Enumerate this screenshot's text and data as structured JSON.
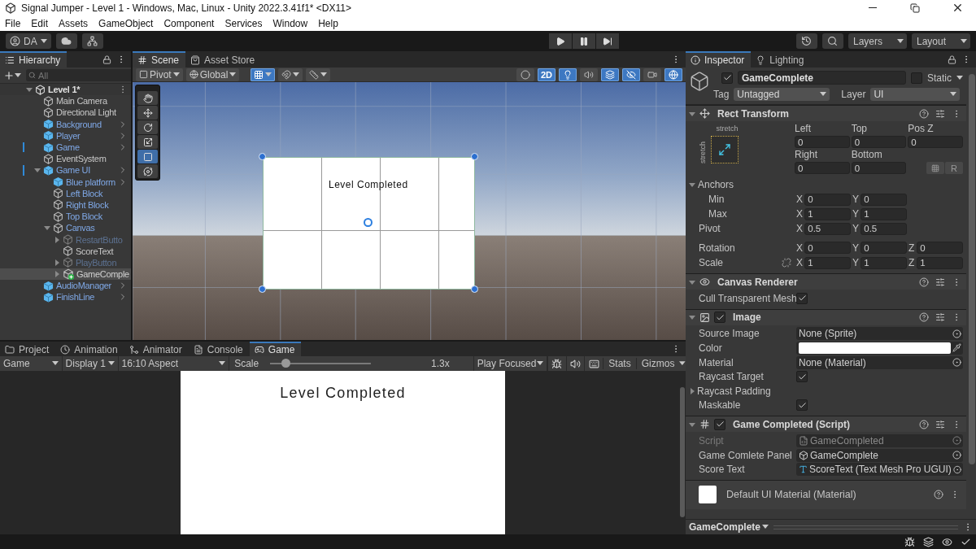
{
  "window": {
    "title": "Signal Jumper - Level 1 - Windows, Mac, Linux - Unity 2022.3.41f1* <DX11>"
  },
  "menu": [
    "File",
    "Edit",
    "Assets",
    "GameObject",
    "Component",
    "Services",
    "Window",
    "Help"
  ],
  "toolbar": {
    "account": "DA",
    "layers": "Layers",
    "layout": "Layout"
  },
  "hierarchy": {
    "tab": "Hierarchy",
    "search": {
      "placeholder": "All"
    },
    "root": {
      "label": "Level 1*",
      "expanded": true,
      "children": [
        {
          "label": "Main Camera",
          "kind": "object",
          "selected": false,
          "disabled": false,
          "modified": false
        },
        {
          "label": "Directional Light",
          "kind": "object",
          "selected": false,
          "disabled": false,
          "modified": false
        },
        {
          "label": "Background",
          "kind": "prefab",
          "selected": false,
          "disabled": false,
          "modified": false
        },
        {
          "label": "Player",
          "kind": "prefab",
          "selected": false,
          "disabled": false,
          "modified": false
        },
        {
          "label": "Game",
          "kind": "prefab",
          "selected": false,
          "disabled": false,
          "modified": true
        },
        {
          "label": "EventSystem",
          "kind": "object",
          "selected": false,
          "disabled": false,
          "modified": false
        },
        {
          "label": "Game UI",
          "kind": "prefab",
          "selected": false,
          "disabled": false,
          "modified": true,
          "expanded": true,
          "children": [
            {
              "label": "Blue platform",
              "kind": "prefab",
              "selected": false,
              "disabled": false,
              "modified": false
            },
            {
              "label": "Left Block",
              "kind": "prefab-part",
              "selected": false,
              "disabled": false,
              "modified": false
            },
            {
              "label": "Right Block",
              "kind": "prefab-part",
              "selected": false,
              "disabled": false,
              "modified": false
            },
            {
              "label": "Top Block",
              "kind": "prefab-part",
              "selected": false,
              "disabled": false,
              "modified": false
            },
            {
              "label": "Canvas",
              "kind": "prefab-part",
              "selected": false,
              "disabled": false,
              "modified": false,
              "expanded": true,
              "children": [
                {
                  "label": "RestartButto",
                  "kind": "prefab-part",
                  "selected": false,
                  "disabled": true,
                  "modified": false,
                  "expanded": false
                },
                {
                  "label": "ScoreText",
                  "kind": "object",
                  "selected": false,
                  "disabled": false,
                  "modified": false
                },
                {
                  "label": "PlayButton",
                  "kind": "prefab-part",
                  "selected": false,
                  "disabled": true,
                  "modified": false,
                  "expanded": false
                },
                {
                  "label": "GameComple",
                  "kind": "added",
                  "selected": true,
                  "disabled": false,
                  "modified": false,
                  "expanded": false
                }
              ]
            }
          ]
        },
        {
          "label": "AudioManager",
          "kind": "prefab",
          "selected": false,
          "disabled": false,
          "modified": false
        },
        {
          "label": "FinishLine",
          "kind": "prefab",
          "selected": false,
          "disabled": false,
          "modified": false
        }
      ]
    }
  },
  "scene": {
    "tabs": [
      {
        "label": "Scene",
        "kind": "scene",
        "selected": true
      },
      {
        "label": "Asset Store",
        "kind": "store",
        "selected": false
      }
    ],
    "pivot": "Pivot",
    "space": "Global",
    "snap_buttons": [
      {
        "kind": "grid",
        "on": true
      },
      {
        "kind": "increment",
        "on": false
      },
      {
        "kind": "ruler",
        "on": false
      }
    ],
    "view_buttons": [
      {
        "kind": "shading",
        "on": false
      },
      {
        "kind": "mode",
        "label": "2D",
        "on": true
      },
      {
        "kind": "light",
        "on": true
      },
      {
        "kind": "audio",
        "on": false
      },
      {
        "kind": "effects",
        "on": true
      },
      {
        "kind": "visibility",
        "on": true
      },
      {
        "kind": "camera",
        "on": false
      },
      {
        "kind": "gizmos",
        "on": true
      }
    ],
    "tools": [
      {
        "kind": "hand",
        "selected": false
      },
      {
        "kind": "move",
        "selected": false
      },
      {
        "kind": "rotate",
        "selected": false
      },
      {
        "kind": "scale",
        "selected": false
      },
      {
        "kind": "rect",
        "selected": true
      },
      {
        "kind": "transform",
        "selected": false
      }
    ],
    "panel_text": "Level Completed"
  },
  "bottom": {
    "tabs": [
      {
        "label": "Project",
        "kind": "project",
        "selected": false
      },
      {
        "label": "Animation",
        "kind": "animation",
        "selected": false
      },
      {
        "label": "Animator",
        "kind": "animator",
        "selected": false
      },
      {
        "label": "Console",
        "kind": "console",
        "selected": false
      },
      {
        "label": "Game",
        "kind": "game",
        "selected": true
      }
    ],
    "game_toolbar": {
      "view": "Game",
      "display": "Display 1",
      "aspect": "16:10 Aspect",
      "scale_label": "Scale",
      "scale": {
        "level": 0.12
      },
      "scale_value": "1.3x",
      "play_mode": "Play Focused",
      "stats": "Stats",
      "gizmos": "Gizmos"
    },
    "game_text": "Level Completed"
  },
  "inspector": {
    "tabs": [
      {
        "label": "Inspector",
        "kind": "inspector",
        "selected": true
      },
      {
        "label": "Lighting",
        "kind": "lighting",
        "selected": false
      }
    ],
    "object": {
      "active": true,
      "name": "GameComplete",
      "static": false,
      "static_label": "Static",
      "tag_label": "Tag",
      "tag": "Untagged",
      "layer_label": "Layer",
      "layer": "UI"
    },
    "rect_transform": {
      "title": "Rect Transform",
      "expanded": true,
      "preset_h": "stretch",
      "preset_v": "stretch",
      "fields": [
        {
          "label": "Left",
          "value": "0"
        },
        {
          "label": "Top",
          "value": "0"
        },
        {
          "label": "Pos Z",
          "value": "0"
        },
        {
          "label": "Right",
          "value": "0"
        },
        {
          "label": "Bottom",
          "value": "0"
        }
      ],
      "raw_button": "R",
      "anchors": {
        "label": "Anchors",
        "expanded": true,
        "rows": [
          {
            "label": "Min",
            "components": [
              {
                "axis": "X",
                "value": "0"
              },
              {
                "axis": "Y",
                "value": "0"
              }
            ]
          },
          {
            "label": "Max",
            "components": [
              {
                "axis": "X",
                "value": "1"
              },
              {
                "axis": "Y",
                "value": "1"
              }
            ]
          }
        ]
      },
      "vectors": [
        {
          "label": "Pivot",
          "components": [
            {
              "axis": "X",
              "value": "0.5"
            },
            {
              "axis": "Y",
              "value": "0.5"
            }
          ]
        },
        {
          "label": "Rotation",
          "components": [
            {
              "axis": "X",
              "value": "0"
            },
            {
              "axis": "Y",
              "value": "0"
            },
            {
              "axis": "Z",
              "value": "0"
            }
          ]
        },
        {
          "label": "Scale",
          "linked": false,
          "components": [
            {
              "axis": "X",
              "value": "1"
            },
            {
              "axis": "Y",
              "value": "1"
            },
            {
              "axis": "Z",
              "value": "1"
            }
          ]
        }
      ]
    },
    "components": [
      {
        "kind": "canvas-renderer",
        "title": "Canvas Renderer",
        "expanded": true,
        "properties": [
          {
            "kind": "check",
            "label": "Cull Transparent Mesh",
            "checked": true
          }
        ]
      },
      {
        "kind": "image",
        "title": "Image",
        "enabled": true,
        "expanded": true,
        "properties": [
          {
            "kind": "object",
            "label": "Source Image",
            "value": "None (Sprite)",
            "disabled": false
          },
          {
            "kind": "color",
            "label": "Color",
            "color": "#ffffff"
          },
          {
            "kind": "object",
            "label": "Material",
            "value": "None (Material)",
            "disabled": false
          },
          {
            "kind": "check",
            "label": "Raycast Target",
            "checked": true
          },
          {
            "kind": "foldout",
            "label": "Raycast Padding",
            "expanded": false
          },
          {
            "kind": "check",
            "label": "Maskable",
            "checked": true
          }
        ]
      },
      {
        "kind": "script",
        "title": "Game Completed (Script)",
        "enabled": true,
        "expanded": true,
        "properties": [
          {
            "kind": "script",
            "label": "Script",
            "value": "GameCompleted",
            "disabled": true
          },
          {
            "kind": "gameobject",
            "label": "Game Comlete Panel",
            "value": "GameComplete",
            "disabled": false
          },
          {
            "kind": "component",
            "label": "Score Text",
            "value": "ScoreText (Text Mesh Pro UGUI)",
            "disabled": false
          }
        ]
      }
    ],
    "material": {
      "title": "Default UI Material (Material)"
    },
    "footer": "GameComplete"
  }
}
